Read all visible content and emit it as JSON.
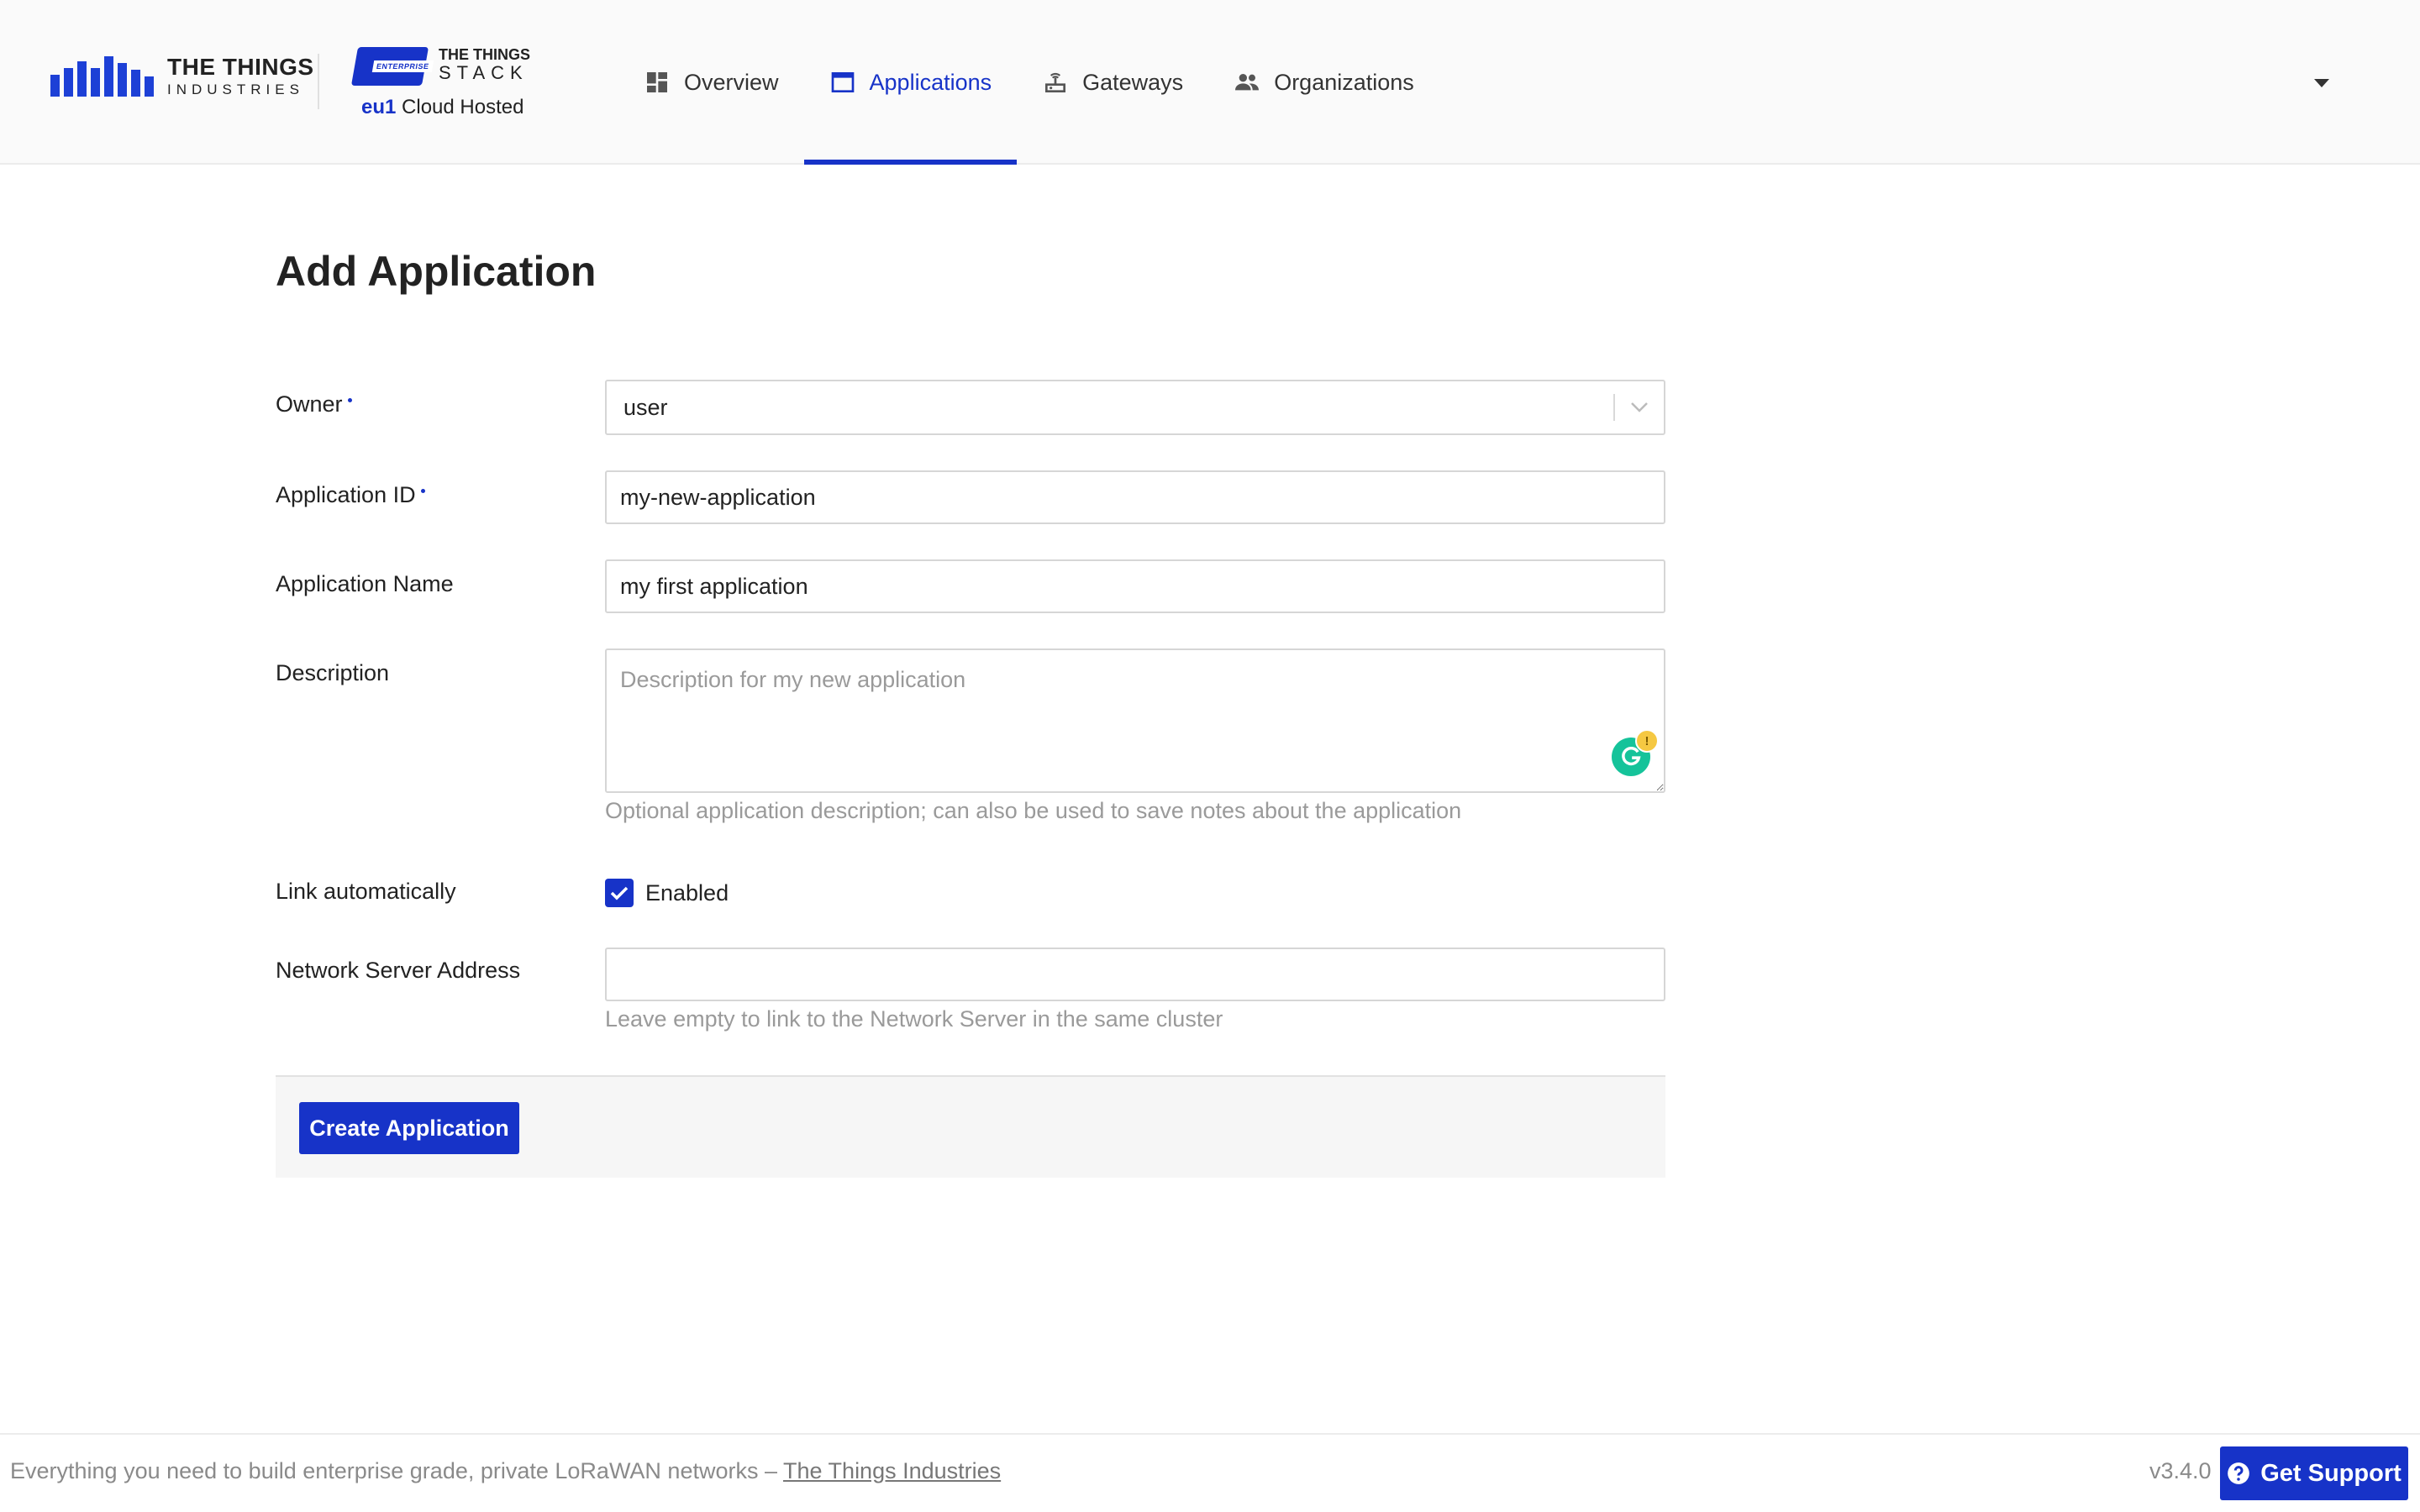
{
  "brand": {
    "company_line1": "THE THINGS",
    "company_line2": "INDUSTRIES",
    "product_badge": "ENTERPRISE",
    "product_line1": "THE THINGS",
    "product_line2": "STACK",
    "cluster": "eu1",
    "cluster_suffix": "Cloud Hosted",
    "accent_color": "#1733c8"
  },
  "nav": {
    "items": [
      {
        "label": "Overview",
        "icon": "dashboard-icon",
        "active": false
      },
      {
        "label": "Applications",
        "icon": "application-window-icon",
        "active": true
      },
      {
        "label": "Gateways",
        "icon": "gateway-router-icon",
        "active": false
      },
      {
        "label": "Organizations",
        "icon": "people-icon",
        "active": false
      }
    ],
    "user_menu_icon": "caret-down-icon"
  },
  "form": {
    "title": "Add Application",
    "owner": {
      "label": "Owner",
      "value": "user"
    },
    "app_id": {
      "label": "Application ID",
      "value": "my-new-application"
    },
    "app_name": {
      "label": "Application Name",
      "value": "my first application"
    },
    "description": {
      "label": "Description",
      "placeholder": "Description for my new application",
      "hint": "Optional application description; can also be used to save notes about the application"
    },
    "link": {
      "label": "Link automatically",
      "checkbox_label": "Enabled",
      "checked": true
    },
    "ns_address": {
      "label": "Network Server Address",
      "value": "",
      "hint": "Leave empty to link to the Network Server in the same cluster"
    },
    "submit_label": "Create Application"
  },
  "footer": {
    "tagline": "Everything you need to build enterprise grade, private LoRaWAN networks –",
    "link_text": "The Things Industries",
    "version": "v3.4.0",
    "support_label": "Get Support"
  }
}
